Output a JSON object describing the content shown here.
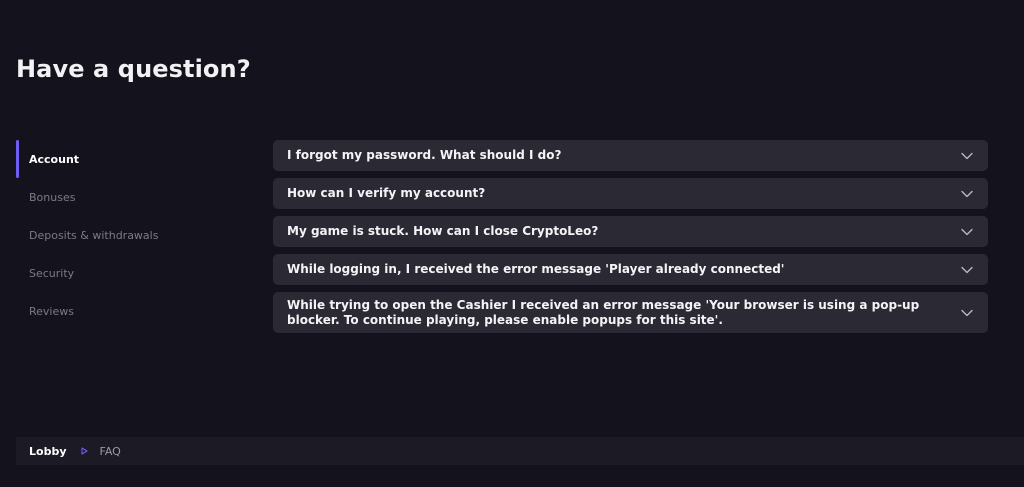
{
  "page": {
    "title": "Have a question?"
  },
  "sidebar": {
    "items": [
      {
        "label": "Account",
        "active": true
      },
      {
        "label": "Bonuses",
        "active": false
      },
      {
        "label": "Deposits & withdrawals",
        "active": false
      },
      {
        "label": "Security",
        "active": false
      },
      {
        "label": "Reviews",
        "active": false
      }
    ]
  },
  "faq": {
    "items": [
      {
        "question": "I forgot my password. What should I do?",
        "icon": "chevron-down-icon"
      },
      {
        "question": "How can I verify my account?",
        "icon": "chevron-down-icon"
      },
      {
        "question": "My game is stuck. How can I close CryptoLeo?",
        "icon": "chevron-down-icon"
      },
      {
        "question": "While logging in, I received the error message 'Player already connected'",
        "icon": "chevron-down-icon"
      },
      {
        "question": "While trying to open the Cashier I received an error message 'Your browser is using a pop-up blocker. To continue playing, please enable popups for this site'.",
        "icon": "chevron-down-icon"
      }
    ]
  },
  "breadcrumb": {
    "items": [
      "Lobby",
      "FAQ"
    ],
    "separator_icon": "triangle-right-icon"
  },
  "colors": {
    "background": "#13121d",
    "card": "#2a2934",
    "accent": "#6e5ef0",
    "footer": "#1b1a25",
    "muted_text": "#7b7a88"
  }
}
